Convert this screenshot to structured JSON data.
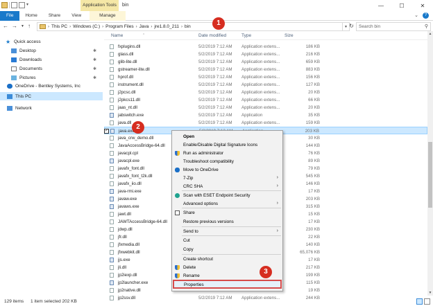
{
  "window": {
    "contextual_tab_group": "Application Tools",
    "title": "bin"
  },
  "ribbon": {
    "tabs": [
      "File",
      "Home",
      "Share",
      "View",
      "Manage"
    ]
  },
  "address": {
    "crumbs": [
      "This PC",
      "Windows (C:)",
      "Program Files",
      "Java",
      "jre1.8.0_211",
      "bin"
    ],
    "search_placeholder": "Search bin"
  },
  "nav": {
    "quick_access": "Quick access",
    "items": [
      "Desktop",
      "Downloads",
      "Documents",
      "Pictures"
    ],
    "onedrive": "OneDrive - Bentley Systems, Inc",
    "this_pc": "This PC",
    "network": "Network"
  },
  "columns": {
    "name": "Name",
    "date": "Date modified",
    "type": "Type",
    "size": "Size"
  },
  "files": [
    {
      "name": "fxplugins.dll",
      "date": "5/2/2019 7:12 AM",
      "type": "Application extens...",
      "size": "186 KB"
    },
    {
      "name": "glass.dll",
      "date": "5/2/2019 7:12 AM",
      "type": "Application extens...",
      "size": "216 KB"
    },
    {
      "name": "glib-lite.dll",
      "date": "5/2/2019 7:12 AM",
      "type": "Application extens...",
      "size": "659 KB"
    },
    {
      "name": "gstreamer-lite.dll",
      "date": "5/2/2019 7:12 AM",
      "type": "Application extens...",
      "size": "883 KB"
    },
    {
      "name": "hprof.dll",
      "date": "5/2/2019 7:12 AM",
      "type": "Application extens...",
      "size": "156 KB"
    },
    {
      "name": "instrument.dll",
      "date": "5/2/2019 7:12 AM",
      "type": "Application extens...",
      "size": "127 KB"
    },
    {
      "name": "j2pcsc.dll",
      "date": "5/2/2019 7:12 AM",
      "type": "Application extens...",
      "size": "20 KB"
    },
    {
      "name": "j2pkcs11.dll",
      "date": "5/2/2019 7:12 AM",
      "type": "Application extens...",
      "size": "66 KB"
    },
    {
      "name": "jaas_nt.dll",
      "date": "5/2/2019 7:12 AM",
      "type": "Application extens...",
      "size": "20 KB"
    },
    {
      "name": "jabswitch.exe",
      "date": "5/2/2019 7:12 AM",
      "type": "Application",
      "size": "35 KB"
    },
    {
      "name": "java.dll",
      "date": "5/2/2019 7:12 AM",
      "type": "Application extens...",
      "size": "159 KB"
    },
    {
      "name": "java.exe",
      "date": "5/2/2019 7:12 AM",
      "type": "Application",
      "size": "203 KB"
    },
    {
      "name": "java_crw_demo.dll",
      "date": "",
      "type": "",
      "size": "30 KB"
    },
    {
      "name": "JavaAccessBridge-64.dll",
      "date": "",
      "type": "",
      "size": "144 KB"
    },
    {
      "name": "javacpl.cpl",
      "date": "",
      "type": "",
      "size": "76 KB"
    },
    {
      "name": "javacpl.exe",
      "date": "",
      "type": "",
      "size": "89 KB"
    },
    {
      "name": "javafx_font.dll",
      "date": "",
      "type": "",
      "size": "79 KB"
    },
    {
      "name": "javafx_font_t2k.dll",
      "date": "",
      "type": "",
      "size": "545 KB"
    },
    {
      "name": "javafx_iio.dll",
      "date": "",
      "type": "",
      "size": "146 KB"
    },
    {
      "name": "java-rmi.exe",
      "date": "",
      "type": "",
      "size": "17 KB"
    },
    {
      "name": "javaw.exe",
      "date": "",
      "type": "",
      "size": "203 KB"
    },
    {
      "name": "javaws.exe",
      "date": "",
      "type": "",
      "size": "315 KB"
    },
    {
      "name": "jawt.dll",
      "date": "",
      "type": "",
      "size": "15 KB"
    },
    {
      "name": "JAWTAccessBridge-64.dll",
      "date": "",
      "type": "",
      "size": "17 KB"
    },
    {
      "name": "jdwp.dll",
      "date": "",
      "type": "",
      "size": "230 KB"
    },
    {
      "name": "jfr.dll",
      "date": "",
      "type": "",
      "size": "22 KB"
    },
    {
      "name": "jfxmedia.dll",
      "date": "",
      "type": "",
      "size": "140 KB"
    },
    {
      "name": "jfxwebkit.dll",
      "date": "",
      "type": "",
      "size": "65,076 KB"
    },
    {
      "name": "jjs.exe",
      "date": "",
      "type": "",
      "size": "17 KB"
    },
    {
      "name": "jli.dll",
      "date": "",
      "type": "",
      "size": "217 KB"
    },
    {
      "name": "jp2iexp.dll",
      "date": "",
      "type": "",
      "size": "199 KB"
    },
    {
      "name": "jp2launcher.exe",
      "date": "",
      "type": "",
      "size": "115 KB"
    },
    {
      "name": "jp2native.dll",
      "date": "",
      "type": "",
      "size": "19 KB"
    },
    {
      "name": "jp2ssv.dll",
      "date": "5/2/2019 7:12 AM",
      "type": "Application extens...",
      "size": "244 KB"
    }
  ],
  "context_menu": [
    {
      "label": "Open",
      "bold": true
    },
    {
      "label": "Enable/Disable Digital Signature Icons"
    },
    {
      "label": "Run as administrator",
      "icon": "shield-icon"
    },
    {
      "label": "Troubleshoot compatibility"
    },
    {
      "label": "Move to OneDrive",
      "icon": "onedrive-icon"
    },
    {
      "label": "7-Zip",
      "submenu": true
    },
    {
      "label": "CRC SHA",
      "submenu": true
    },
    {
      "label": "Scan with ESET Endpoint Security",
      "icon": "eset-icon"
    },
    {
      "label": "Advanced options",
      "submenu": true
    },
    {
      "label": "Share",
      "icon": "share-icon"
    },
    {
      "label": "Restore previous versions"
    },
    {
      "label": "Send to",
      "submenu": true
    },
    {
      "label": "Cut"
    },
    {
      "label": "Copy"
    },
    {
      "label": "Create shortcut"
    },
    {
      "label": "Delete",
      "icon": "shield-icon"
    },
    {
      "label": "Rename",
      "icon": "shield-icon"
    },
    {
      "label": "Properties",
      "highlighted": true
    }
  ],
  "status": {
    "count": "129 items",
    "selected": "1 item selected  202 KB"
  },
  "badges": [
    "1",
    "2",
    "3"
  ],
  "colors": {
    "file_tab": "#1979ca",
    "selection": "#cce8ff",
    "badge": "#d62d20",
    "highlight_border": "#d64b4b"
  }
}
